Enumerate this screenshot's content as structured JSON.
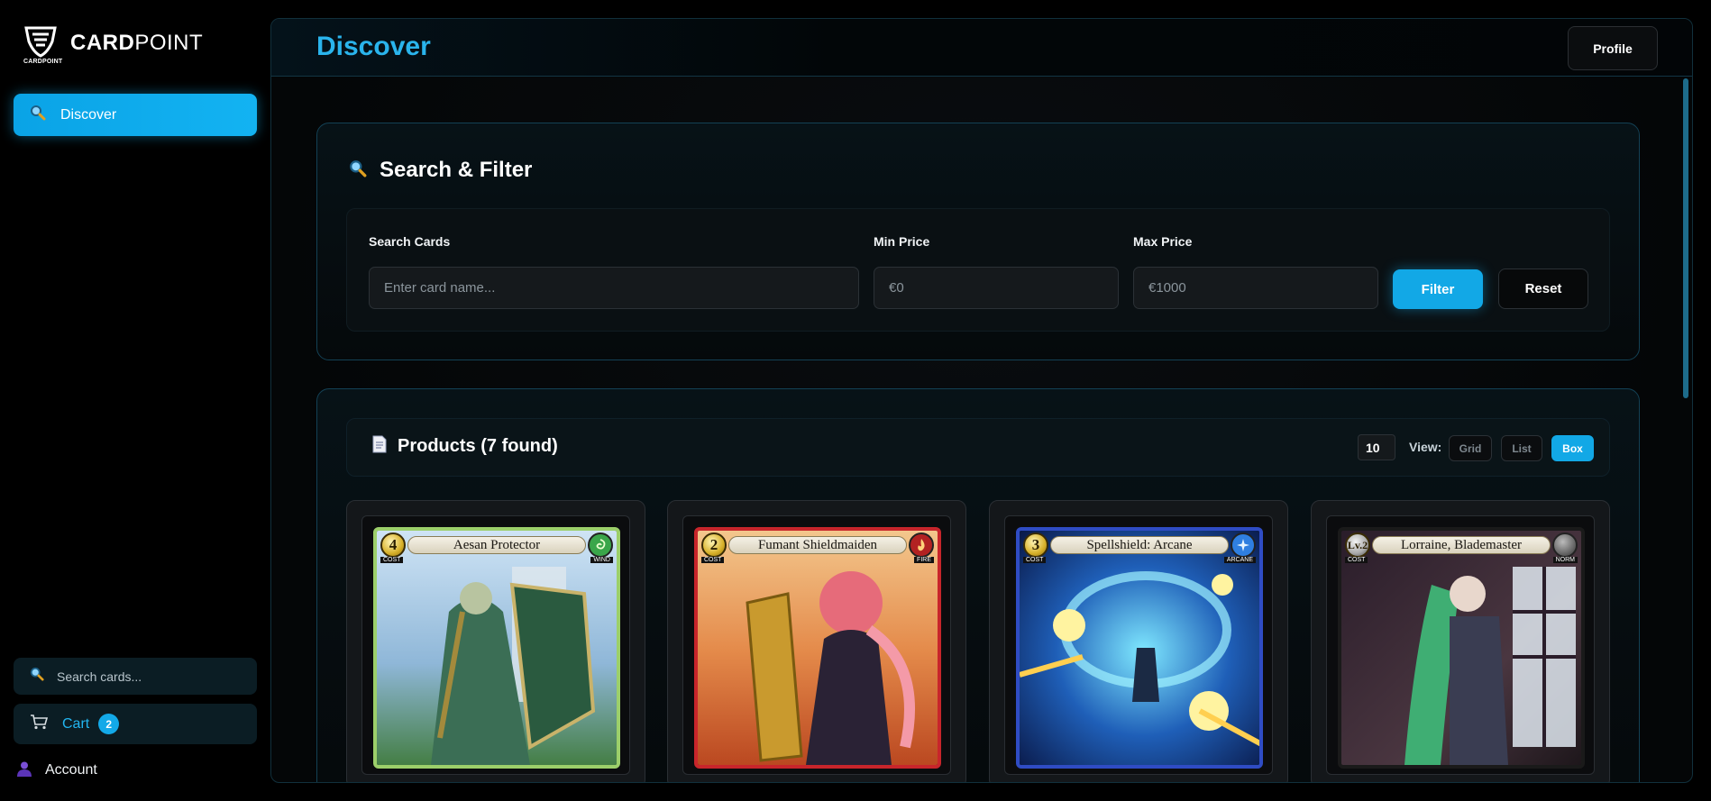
{
  "app": {
    "brand_bold": "CARD",
    "brand_light": "POINT",
    "brand_sub": "CARDPOINT"
  },
  "sidebar": {
    "nav": [
      {
        "label": "Discover",
        "icon": "search-icon",
        "active": true
      }
    ],
    "search_placeholder": "Search cards...",
    "cart": {
      "label": "Cart",
      "count": "2",
      "icon": "cart-icon"
    },
    "account": {
      "label": "Account",
      "icon": "user-icon"
    }
  },
  "header": {
    "title": "Discover",
    "profile_label": "Profile"
  },
  "filter": {
    "title": "Search & Filter",
    "search_label": "Search Cards",
    "search_placeholder": "Enter card name...",
    "min_label": "Min Price",
    "min_placeholder": "€0",
    "max_label": "Max Price",
    "max_placeholder": "€1000",
    "filter_button": "Filter",
    "reset_button": "Reset"
  },
  "products": {
    "title": "Products (7 found)",
    "per_page": "10",
    "view_label": "View:",
    "views": [
      {
        "label": "Grid",
        "active": false
      },
      {
        "label": "List",
        "active": false
      },
      {
        "label": "Box",
        "active": true
      }
    ],
    "cards": [
      {
        "name": "Aesan Protector",
        "cost": "4",
        "cost_caption": "COST",
        "element": "WIND",
        "border_color": "#9ccf6a",
        "element_color": "#3aa64a"
      },
      {
        "name": "Fumant Shieldmaiden",
        "cost": "2",
        "cost_caption": "COST",
        "element": "FIRE",
        "border_color": "#c8252b",
        "element_color": "#b22222"
      },
      {
        "name": "Spellshield: Arcane",
        "cost": "3",
        "cost_caption": "COST",
        "element": "ARCANE",
        "border_color": "#2f4cc4",
        "element_color": "#2f7fe0"
      },
      {
        "name": "Lorraine, Blademaster",
        "cost": "Lv.2",
        "cost_caption": "COST",
        "element": "NORM",
        "border_color": "#1a1a1a",
        "element_color": "#333333"
      }
    ]
  },
  "colors": {
    "accent": "#12a8e6",
    "title": "#2ab4ec",
    "background": "#000000"
  }
}
